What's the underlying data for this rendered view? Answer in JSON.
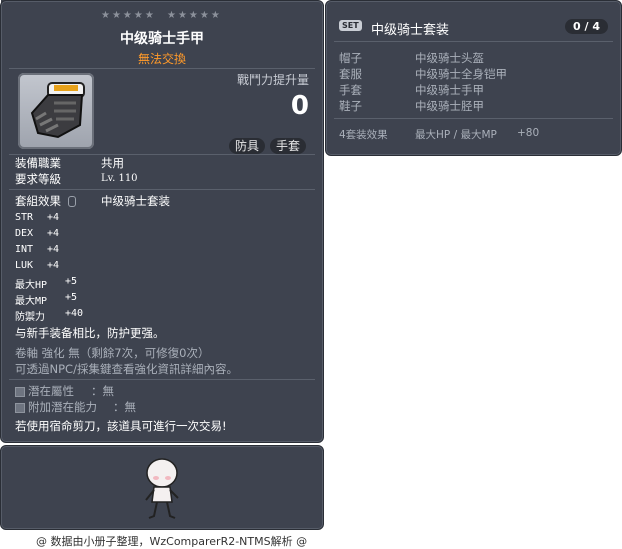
{
  "item_id": "01082455",
  "tooltip": {
    "stars_left": "★★★★★",
    "stars_right": "★★★★★",
    "title": "中级骑士手甲",
    "untradable": "無法交換",
    "combat_power_label": "戰鬥力提升量",
    "combat_power_value": "0",
    "tags": [
      "防具",
      "手套"
    ],
    "job_label": "装備職業",
    "job_value": "共用",
    "level_label": "要求等級",
    "level_value": "Lv. 110",
    "set_effect_label": "套組效果",
    "set_effect_value": "中级骑士套装",
    "stats": [
      {
        "k": "STR",
        "v": "+4"
      },
      {
        "k": "DEX",
        "v": "+4"
      },
      {
        "k": "INT",
        "v": "+4"
      },
      {
        "k": "LUK",
        "v": "+4"
      },
      {
        "k": "最大HP",
        "v": "+5"
      },
      {
        "k": "最大MP",
        "v": "+5"
      },
      {
        "k": "防禦力",
        "v": "+40"
      }
    ],
    "compare_text": "与新手装备相比，防护更强。",
    "scroll_text": "卷軸 強化 無（剩餘7次，可修復0次）",
    "npc_text": "可透過NPC/採集鍵查看強化資訊詳細內容。",
    "potential_label": "潛在屬性",
    "potential_value": "：無",
    "bonus_potential_label": "附加潛在能力",
    "bonus_potential_value": "：無",
    "scissors_text": "若使用宿命剪刀，該道具可進行一次交易!"
  },
  "set_panel": {
    "badge": "SET",
    "title": "中级骑士套装",
    "count": "0 / 4",
    "items": [
      {
        "slot": "帽子",
        "name": "中级骑士头盔"
      },
      {
        "slot": "套服",
        "name": "中级骑士全身铠甲"
      },
      {
        "slot": "手套",
        "name": "中级骑士手甲"
      },
      {
        "slot": "鞋子",
        "name": "中级骑士胫甲"
      }
    ],
    "effect_label": "4套装效果",
    "effect_stat": "最大HP / 最大MP",
    "effect_value": "+80"
  },
  "footer": "@ 数据由小册子整理，WzComparerR2-NTMS解析 @"
}
